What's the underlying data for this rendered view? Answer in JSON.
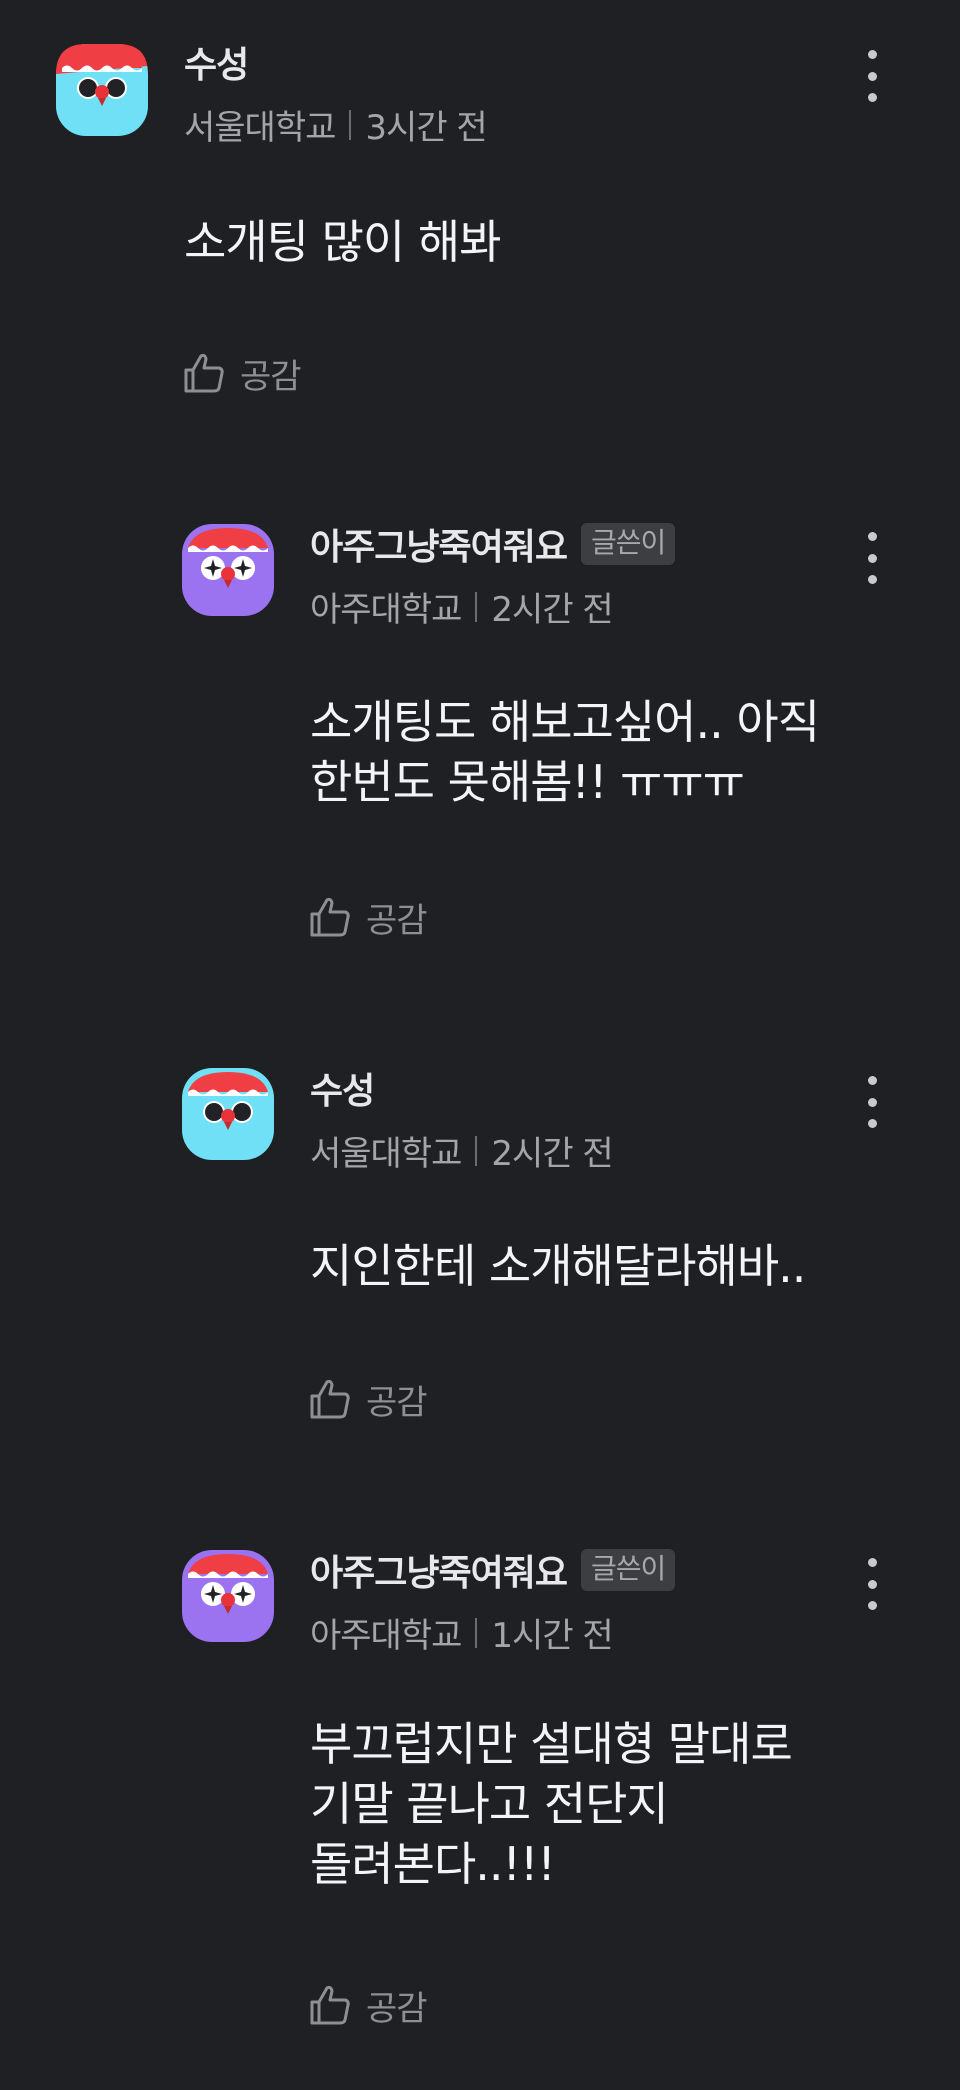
{
  "comments": [
    {
      "author": "수성",
      "badge": "",
      "school": "서울대학교",
      "time": "3시간 전",
      "text": "소개팅 많이 해봐",
      "like_label": "공감",
      "avatar_color": "#6fe0f5"
    },
    {
      "author": "아주그냥죽여줘요",
      "badge": "글쓴이",
      "school": "아주대학교",
      "time": "2시간 전",
      "text": "소개팅도 해보고싶어.. 아직\n한번도 못해봄!! ㅠㅠㅠ",
      "like_label": "공감",
      "avatar_color": "#9b73f0"
    },
    {
      "author": "수성",
      "badge": "",
      "school": "서울대학교",
      "time": "2시간 전",
      "text": "지인한테 소개해달라해바..",
      "like_label": "공감",
      "avatar_color": "#6fe0f5"
    },
    {
      "author": "아주그냥죽여줘요",
      "badge": "글쓴이",
      "school": "아주대학교",
      "time": "1시간 전",
      "text": "부끄럽지만 설대형 말대로\n기말 끝나고 전단지\n돌려본다..!!!",
      "like_label": "공감",
      "avatar_color": "#9b73f0"
    }
  ],
  "icons": {
    "like": "thumbs-up-icon",
    "more": "more-vertical-icon",
    "avatar": "owl-avatar-icon"
  }
}
